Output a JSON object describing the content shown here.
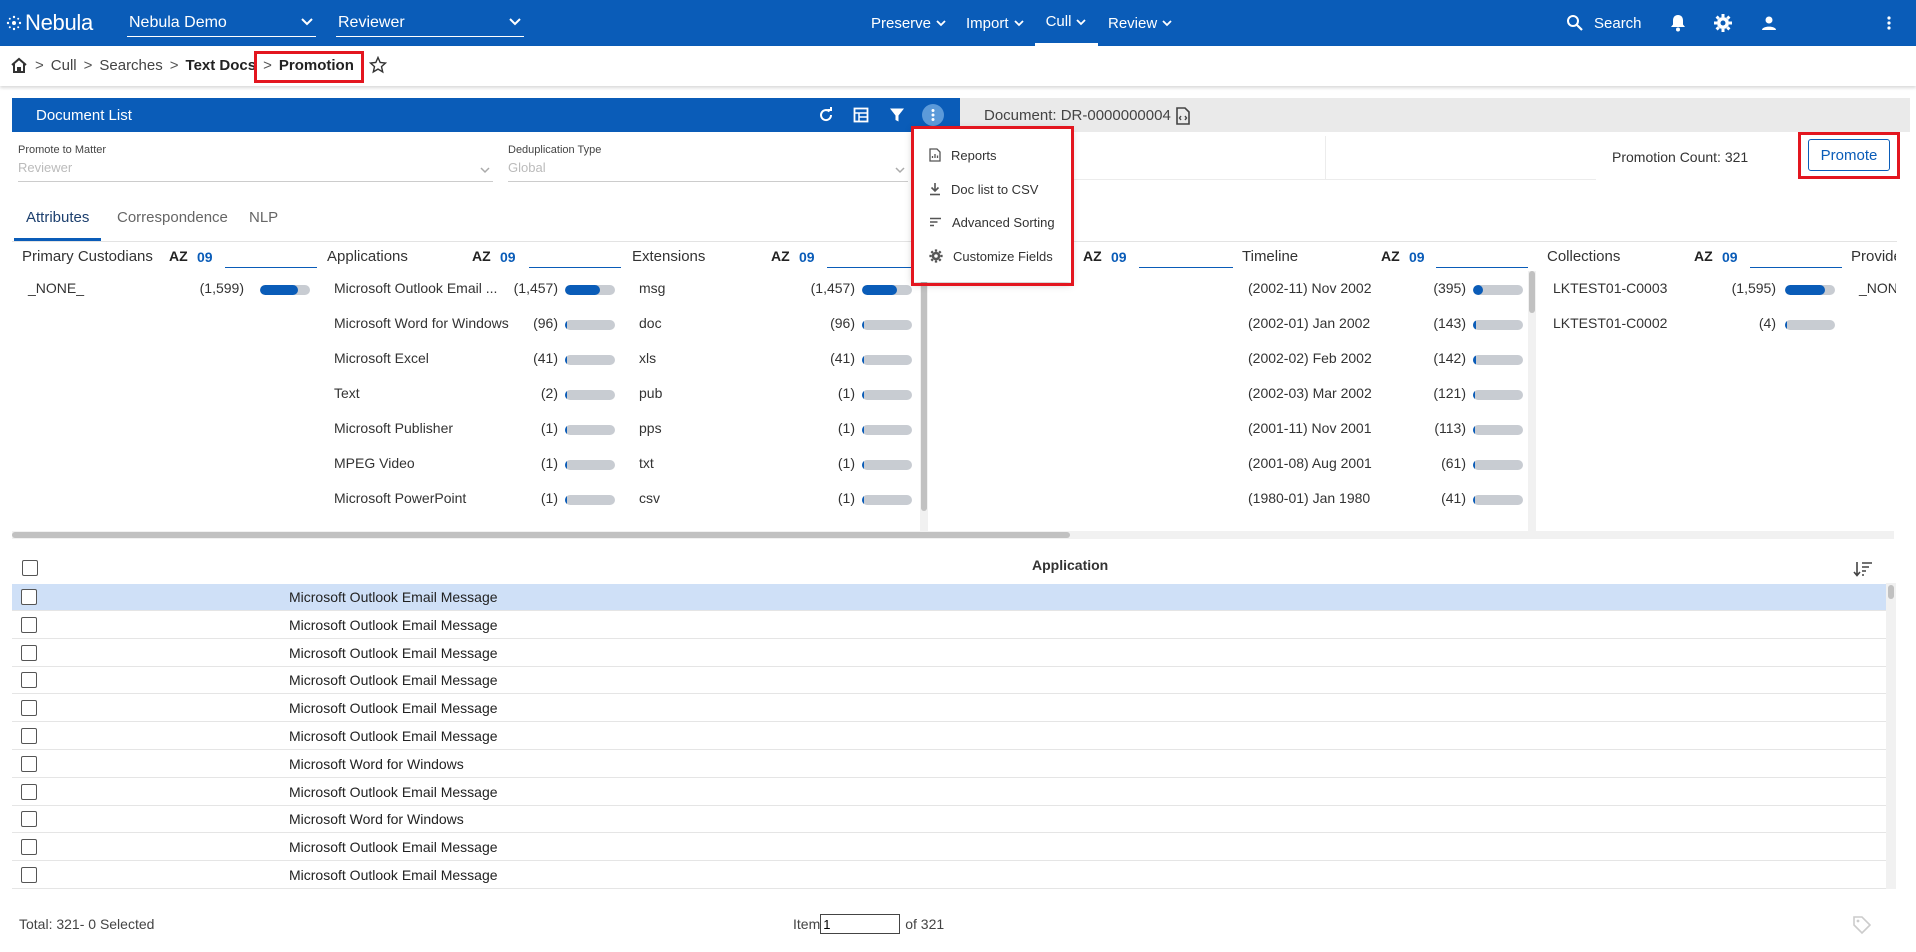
{
  "topbar": {
    "logo": "Nebula",
    "project_select": "Nebula Demo",
    "role_select": "Reviewer",
    "nav": [
      {
        "label": "Preserve"
      },
      {
        "label": "Import"
      },
      {
        "label": "Cull"
      },
      {
        "label": "Review"
      }
    ],
    "search_label": "Search",
    "icons": [
      "bell-icon",
      "gear-icon",
      "user-icon",
      "kebab-icon"
    ]
  },
  "breadcrumb": {
    "items": [
      "Cull",
      "Searches",
      "Text Docs",
      "Promotion"
    ]
  },
  "document_list": {
    "title": "Document List",
    "document_label": "Document: DR-0000000004"
  },
  "filters": {
    "promote_to_matter_label": "Promote to Matter",
    "promote_to_matter_value": "Reviewer",
    "dedup_label": "Deduplication Type",
    "dedup_value": "Global",
    "promotion_count": "Promotion Count: 321",
    "promote_button": "Promote"
  },
  "menu": {
    "items": [
      {
        "label": "Reports",
        "icon": "report-icon"
      },
      {
        "label": "Doc list to CSV",
        "icon": "download-icon"
      },
      {
        "label": "Advanced Sorting",
        "icon": "sort-lines-icon"
      },
      {
        "label": "Customize Fields",
        "icon": "gear-icon"
      }
    ]
  },
  "tabs": [
    "Attributes",
    "Correspondence",
    "NLP"
  ],
  "facets": {
    "az": "AZ",
    "nine": "09",
    "custodians": {
      "title": "Primary Custodians",
      "rows": [
        {
          "label": "_NONE_",
          "count": "(1,599)",
          "fill": 0.75
        }
      ]
    },
    "applications": {
      "title": "Applications",
      "rows": [
        {
          "label": "Microsoft Outlook Email ...",
          "count": "(1,457)",
          "fill": 0.7
        },
        {
          "label": "Microsoft Word for Windows",
          "count": "(96)",
          "fill": 0.04
        },
        {
          "label": "Microsoft Excel",
          "count": "(41)",
          "fill": 0.03
        },
        {
          "label": "Text",
          "count": "(2)",
          "fill": 0.02
        },
        {
          "label": "Microsoft Publisher",
          "count": "(1)",
          "fill": 0.02
        },
        {
          "label": "MPEG Video",
          "count": "(1)",
          "fill": 0.02
        },
        {
          "label": "Microsoft PowerPoint",
          "count": "(1)",
          "fill": 0.02
        }
      ]
    },
    "extensions": {
      "title": "Extensions",
      "rows": [
        {
          "label": "msg",
          "count": "(1,457)",
          "fill": 0.7
        },
        {
          "label": "doc",
          "count": "(96)",
          "fill": 0.04
        },
        {
          "label": "xls",
          "count": "(41)",
          "fill": 0.03
        },
        {
          "label": "pub",
          "count": "(1)",
          "fill": 0.02
        },
        {
          "label": "pps",
          "count": "(1)",
          "fill": 0.02
        },
        {
          "label": "txt",
          "count": "(1)",
          "fill": 0.02
        },
        {
          "label": "csv",
          "count": "(1)",
          "fill": 0.02
        }
      ]
    },
    "timeline": {
      "title": "Timeline",
      "rows": [
        {
          "label": "(2002-11) Nov 2002",
          "count": "(395)",
          "fill": 0.2
        },
        {
          "label": "(2002-01) Jan 2002",
          "count": "(143)",
          "fill": 0.05
        },
        {
          "label": "(2002-02) Feb 2002",
          "count": "(142)",
          "fill": 0.05
        },
        {
          "label": "(2002-03) Mar 2002",
          "count": "(121)",
          "fill": 0.04
        },
        {
          "label": "(2001-11) Nov 2001",
          "count": "(113)",
          "fill": 0.04
        },
        {
          "label": "(2001-08) Aug 2001",
          "count": "(61)",
          "fill": 0.03
        },
        {
          "label": "(1980-01) Jan 1980",
          "count": "(41)",
          "fill": 0.03
        }
      ]
    },
    "collections": {
      "title": "Collections",
      "rows": [
        {
          "label": "LKTEST01-C0003",
          "count": "(1,595)",
          "fill": 0.8
        },
        {
          "label": "LKTEST01-C0002",
          "count": "(4)",
          "fill": 0.02
        }
      ]
    },
    "providers": {
      "title": "Provide",
      "rows": [
        {
          "label": "_NON"
        }
      ]
    }
  },
  "table": {
    "column": "Application",
    "rows": [
      "Microsoft Outlook Email Message",
      "Microsoft Outlook Email Message",
      "Microsoft Outlook Email Message",
      "Microsoft Outlook Email Message",
      "Microsoft Outlook Email Message",
      "Microsoft Outlook Email Message",
      "Microsoft Word for Windows",
      "Microsoft Outlook Email Message",
      "Microsoft Word for Windows",
      "Microsoft Outlook Email Message",
      "Microsoft Outlook Email Message"
    ],
    "selected_row": 0
  },
  "footer": {
    "total": "Total: 321- 0 Selected",
    "item_label": "Item",
    "item_value": "1",
    "of_label": "of 321"
  }
}
